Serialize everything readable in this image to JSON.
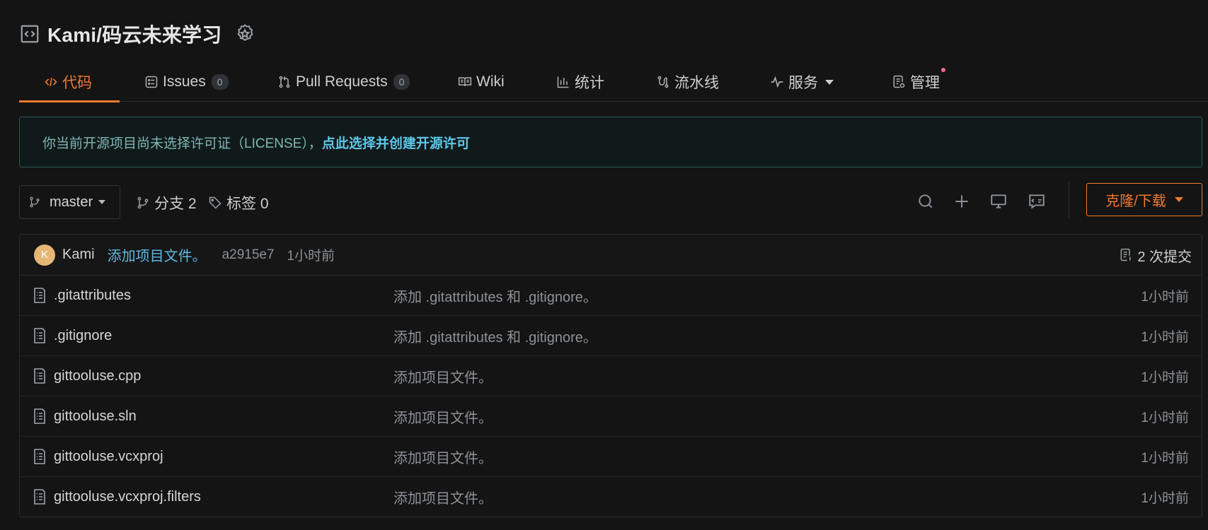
{
  "repo": {
    "title": "Kami/码云未来学习",
    "icon": "code-box-icon",
    "badge_icon": "award-badge-icon"
  },
  "tabs": [
    {
      "label": "代码",
      "icon": "code-icon",
      "active": true
    },
    {
      "label": "Issues",
      "icon": "issues-icon",
      "count": "0"
    },
    {
      "label": "Pull Requests",
      "icon": "pull-request-icon",
      "count": "0"
    },
    {
      "label": "Wiki",
      "icon": "book-icon"
    },
    {
      "label": "统计",
      "icon": "bar-chart-icon"
    },
    {
      "label": "流水线",
      "icon": "pipeline-icon"
    },
    {
      "label": "服务",
      "icon": "pulse-icon",
      "has_dropdown": true
    },
    {
      "label": "管理",
      "icon": "settings-doc-icon",
      "has_notification": true
    }
  ],
  "license_banner": {
    "text": "你当前开源项目尚未选择许可证（LICENSE），",
    "link": "点此选择并创建开源许可"
  },
  "toolbar": {
    "branch": "master",
    "branches_label": "分支 2",
    "tags_label": "标签 0",
    "clone_label": "克隆/下载"
  },
  "latest_commit": {
    "avatar_letter": "K",
    "author": "Kami",
    "message": "添加项目文件。",
    "hash": "a2915e7",
    "time": "1小时前",
    "commit_count": "2 次提交"
  },
  "files": [
    {
      "name": ".gitattributes",
      "commit": "添加 .gitattributes 和 .gitignore。",
      "time": "1小时前"
    },
    {
      "name": ".gitignore",
      "commit": "添加 .gitattributes 和 .gitignore。",
      "time": "1小时前"
    },
    {
      "name": "gittooluse.cpp",
      "commit": "添加项目文件。",
      "time": "1小时前"
    },
    {
      "name": "gittooluse.sln",
      "commit": "添加项目文件。",
      "time": "1小时前"
    },
    {
      "name": "gittooluse.vcxproj",
      "commit": "添加项目文件。",
      "time": "1小时前"
    },
    {
      "name": "gittooluse.vcxproj.filters",
      "commit": "添加项目文件。",
      "time": "1小时前"
    }
  ],
  "colors": {
    "accent": "#f07a2e",
    "link": "#5fb9e0",
    "background": "#141414",
    "notification": "#ff6b88"
  }
}
